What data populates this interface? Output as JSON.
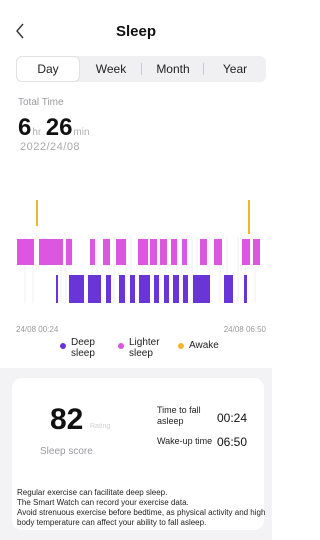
{
  "header": {
    "title": "Sleep",
    "back_icon": "chevron-left-icon"
  },
  "tabs": [
    "Day",
    "Week",
    "Month",
    "Year"
  ],
  "active_tab": "Day",
  "summary": {
    "total_label": "Total Time",
    "hours": "6",
    "hours_unit": "hr",
    "minutes": "26",
    "minutes_unit": "min",
    "date": "2022/24/08"
  },
  "chart_times": {
    "start": "24/08 00:24",
    "end": "24/08 06:50"
  },
  "legend": [
    {
      "label": "Deep sleep",
      "color": "#6a35d6"
    },
    {
      "label": "Lighter sleep",
      "color": "#dc56e0"
    },
    {
      "label": "Awake",
      "color": "#f3b62b"
    }
  ],
  "score": {
    "value": "82",
    "rating_label": "Rating",
    "label": "Sleep score",
    "fall_asleep_label": "Time to fall asleep",
    "fall_asleep_value": "00:24",
    "wake_label": "Wake-up time",
    "wake_value": "06:50"
  },
  "tips": [
    "Regular exercise can facilitate deep sleep.",
    "The Smart Watch can record your exercise data.",
    "Avoid strenuous exercise before bedtime, as physical activity and high body temperature can affect your ability to fall asleep."
  ]
}
